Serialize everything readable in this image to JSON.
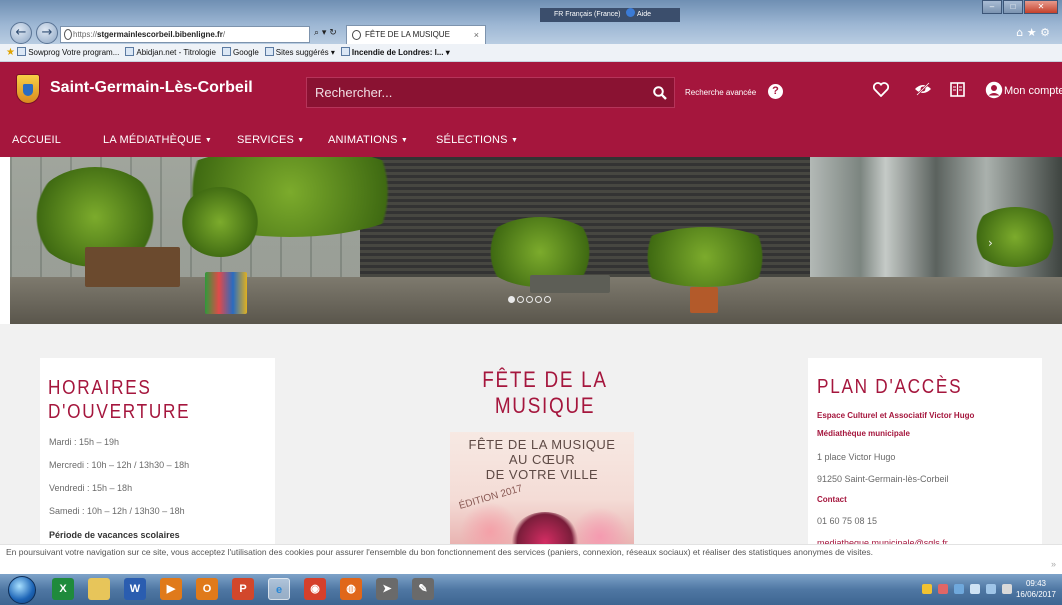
{
  "browser": {
    "address_prefix": "https://",
    "address_host": "stgermainlescorbeil.bibenligne.fr",
    "address_suffix": "/",
    "address_tools": "⌕ ▾ ↻",
    "tab_title": "FÊTE DE LA MUSIQUE",
    "tab_close": "×",
    "lang_label": "FR Français (France)",
    "help_label": "Aide",
    "chrome_icons": "⌂ ★ ⚙",
    "favorites": [
      {
        "label": "Sowprog  Votre program...",
        "bold": false
      },
      {
        "label": "Abidjan.net - Titrologie",
        "bold": false
      },
      {
        "label": "Google",
        "bold": false
      },
      {
        "label": "Sites suggérés ▾",
        "bold": false
      },
      {
        "label": "Incendie de Londres: l... ▾",
        "bold": true
      }
    ]
  },
  "header": {
    "site_title": "Saint-Germain-Lès-Corbeil",
    "search_placeholder": "Rechercher...",
    "advanced_search": "Recherche avancée",
    "help": "?",
    "account": "Mon compte",
    "brand_color": "#a5163d"
  },
  "nav": {
    "items": [
      {
        "label": "ACCUEIL",
        "caret": ""
      },
      {
        "label": "LA MÉDIATHÈQUE",
        "caret": "▼"
      },
      {
        "label": "SERVICES",
        "caret": "▼"
      },
      {
        "label": "ANIMATIONS",
        "caret": "▼"
      },
      {
        "label": "SÉLECTIONS",
        "caret": "▼"
      }
    ]
  },
  "hero": {
    "slide_count": 5,
    "active_slide": 1,
    "next": "›"
  },
  "hours": {
    "title_line1": "HORAIRES",
    "title_line2": "D'OUVERTURE",
    "rows": [
      "Mardi : 15h – 19h",
      "Mercredi : 10h – 12h / 13h30 – 18h",
      "Vendredi : 15h – 18h",
      "Samedi : 10h – 12h / 13h30 – 18h"
    ],
    "vacation_label": "Période de vacances scolaires"
  },
  "event": {
    "title": "FÊTE DE LA MUSIQUE",
    "poster_line1": "FÊTE DE LA MUSIQUE",
    "poster_line2": "AU CŒUR",
    "poster_line3": "DE VOTRE VILLE",
    "poster_edition": "ÉDITION 2017"
  },
  "access": {
    "title": "PLAN D'ACCÈS",
    "venue": "Espace Culturel et Associatif Victor Hugo",
    "library": "Médiathèque municipale",
    "street": "1 place Victor Hugo",
    "city": "91250 Saint-Germain-lès-Corbeil",
    "contact_label": "Contact",
    "phone": "01 60 75 08 15",
    "email": "mediatheque.municipale@sgls.fr"
  },
  "cookie": {
    "text": "En poursuivant votre navigation sur ce site, vous acceptez l'utilisation des cookies pour assurer l'ensemble du bon fonctionnement des services (paniers, connexion, réseaux sociaux) et réaliser des statistiques anonymes de visites.",
    "close": "»"
  },
  "taskbar": {
    "apps": [
      {
        "name": "excel-icon",
        "glyph": "X",
        "color": "#1f8a3c"
      },
      {
        "name": "explorer-icon",
        "glyph": "",
        "color": "#e7c55a"
      },
      {
        "name": "word-icon",
        "glyph": "W",
        "color": "#2a5db0"
      },
      {
        "name": "media-player-icon",
        "glyph": "▶",
        "color": "#e07a1a"
      },
      {
        "name": "outlook-icon",
        "glyph": "O",
        "color": "#e07a1a"
      },
      {
        "name": "powerpoint-icon",
        "glyph": "P",
        "color": "#d2472b"
      },
      {
        "name": "ie-icon",
        "glyph": "e",
        "color": "#2a88d6"
      },
      {
        "name": "chrome-icon",
        "glyph": "◉",
        "color": "#d6402b"
      },
      {
        "name": "firefox-icon",
        "glyph": "◍",
        "color": "#e0671a"
      },
      {
        "name": "shortcut-icon",
        "glyph": "➤",
        "color": "#6a6a6a"
      },
      {
        "name": "misc-icon",
        "glyph": "✎",
        "color": "#6a6a6a"
      }
    ],
    "active_app": "ie-icon",
    "time": "09:43",
    "date": "16/06/2017"
  }
}
